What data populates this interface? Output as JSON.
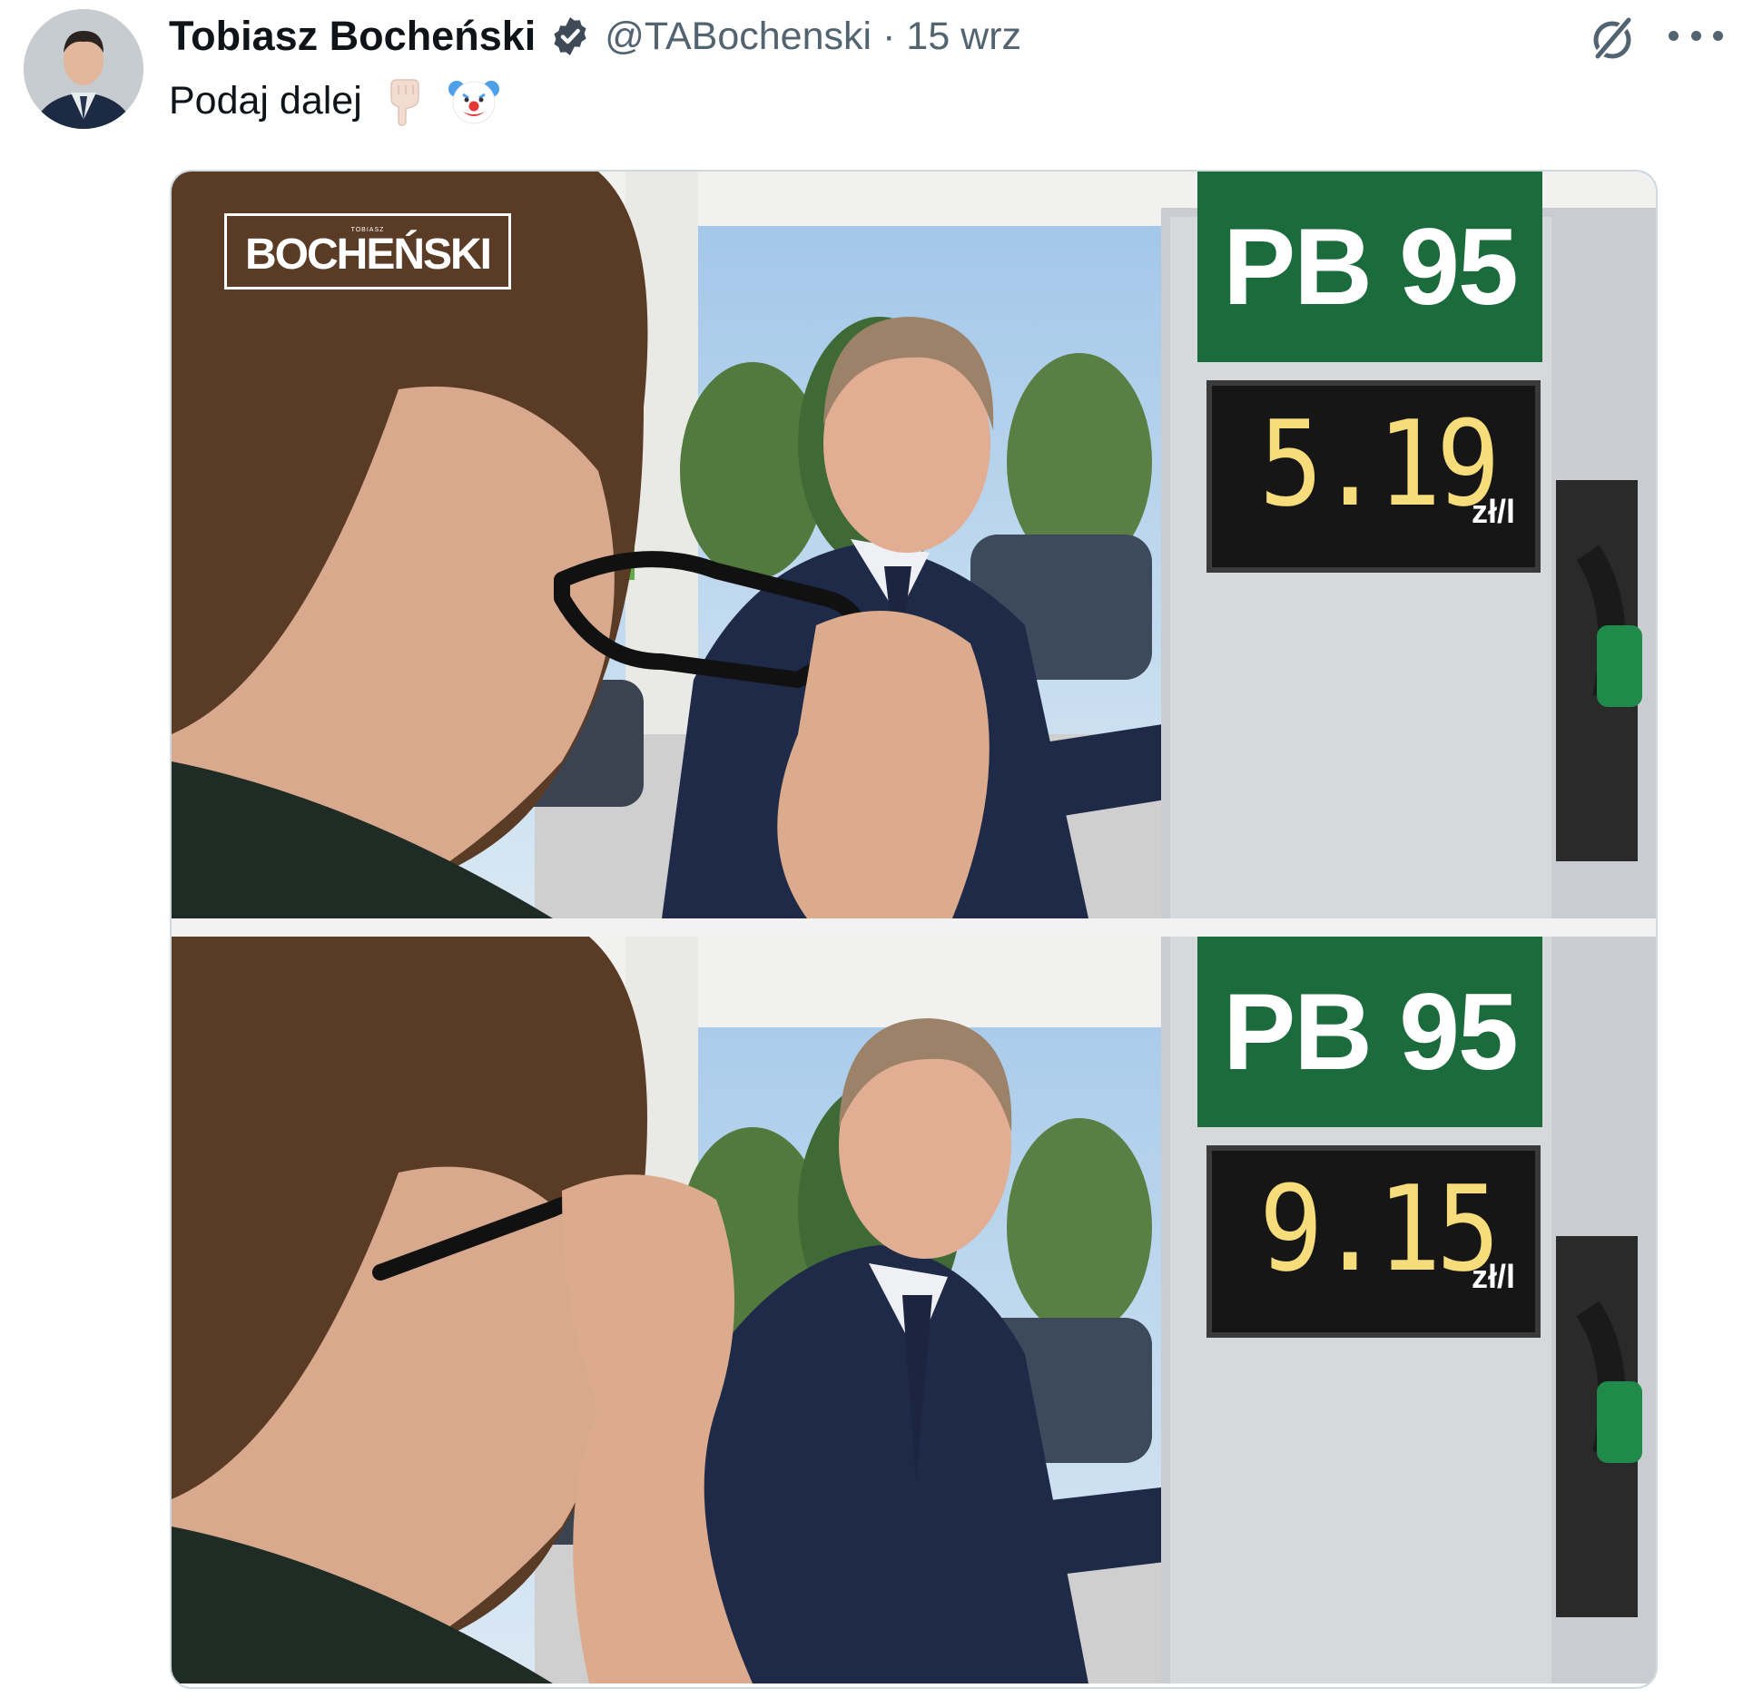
{
  "tweet": {
    "author_name": "Tobiasz Bocheński",
    "handle": "@TABochenski",
    "separator": "·",
    "date": "15 wrz",
    "text": "Podaj dalej",
    "emojis": [
      "pointing-down-hand-icon",
      "clown-face-icon"
    ],
    "verified": true,
    "accent_color": "#1d9bf0"
  },
  "media": {
    "watermark": {
      "small_text": "TOBIASZ",
      "brand_text": "BOCHEŃSKI"
    },
    "panels": [
      {
        "fuel_label": "PB 95",
        "price": "5.19",
        "unit": "zł/l"
      },
      {
        "fuel_label": "PB 95",
        "price": "9.15",
        "unit": "zł/l"
      }
    ],
    "colors": {
      "sign_green": "#1b6b3d",
      "price_digits": "#f6dc7a"
    }
  }
}
